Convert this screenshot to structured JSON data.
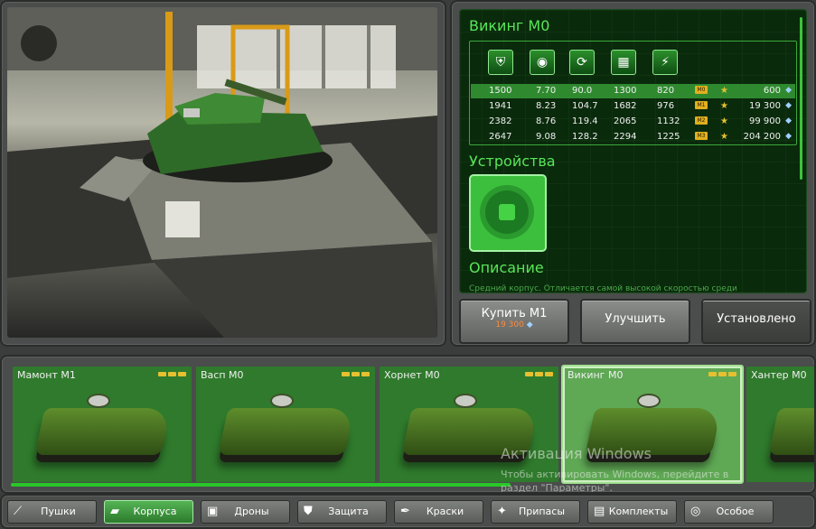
{
  "info": {
    "title": "Викинг М0",
    "devices_title": "Устройства",
    "description_title": "Описание",
    "description_text": "Средний корпус. Отличается самой высокой скоростью среди",
    "stat_icons": [
      "armor-icon",
      "speed-icon",
      "turn-speed-icon",
      "weight-icon",
      "power-icon"
    ],
    "rows": [
      {
        "armor": "1500",
        "speed": "7.70",
        "turn": "90.0",
        "weight": "1300",
        "power": "820",
        "mod": "M0",
        "price": "600",
        "active": true
      },
      {
        "armor": "1941",
        "speed": "8.23",
        "turn": "104.7",
        "weight": "1682",
        "power": "976",
        "mod": "M1",
        "price": "19 300",
        "active": false
      },
      {
        "armor": "2382",
        "speed": "8.76",
        "turn": "119.4",
        "weight": "2065",
        "power": "1132",
        "mod": "M2",
        "price": "99 900",
        "active": false
      },
      {
        "armor": "2647",
        "speed": "9.08",
        "turn": "128.2",
        "weight": "2294",
        "power": "1225",
        "mod": "M3",
        "price": "204 200",
        "active": false
      }
    ]
  },
  "actions": {
    "buy_label": "Купить М1",
    "buy_price": "19 300",
    "upgrade_label": "Улучшить",
    "installed_label": "Установлено"
  },
  "items": [
    {
      "name": "Мамонт М1",
      "selected": false
    },
    {
      "name": "Васп М0",
      "selected": false
    },
    {
      "name": "Хорнет М0",
      "selected": false
    },
    {
      "name": "Викинг М0",
      "selected": true
    },
    {
      "name": "Хантер М0",
      "selected": false
    }
  ],
  "watermark": {
    "title": "Активация Windows",
    "line1": "Чтобы активировать Windows, перейдите в",
    "line2": "раздел \"Параметры\"."
  },
  "tabs": [
    {
      "label": "Пушки",
      "icon": "gun-icon",
      "active": false
    },
    {
      "label": "Корпуса",
      "icon": "hull-icon",
      "active": true
    },
    {
      "label": "Дроны",
      "icon": "drone-icon",
      "active": false
    },
    {
      "label": "Защита",
      "icon": "shield-icon",
      "active": false
    },
    {
      "label": "Краски",
      "icon": "paint-icon",
      "active": false
    },
    {
      "label": "Припасы",
      "icon": "supplies-icon",
      "active": false
    },
    {
      "label": "Комплекты",
      "icon": "kits-icon",
      "active": false
    },
    {
      "label": "Особое",
      "icon": "special-icon",
      "active": false
    }
  ],
  "colors": {
    "accent": "#59e659",
    "panel": "#0a2a0c",
    "selected_row": "#2f8a2f",
    "price": "#ff8a40"
  }
}
